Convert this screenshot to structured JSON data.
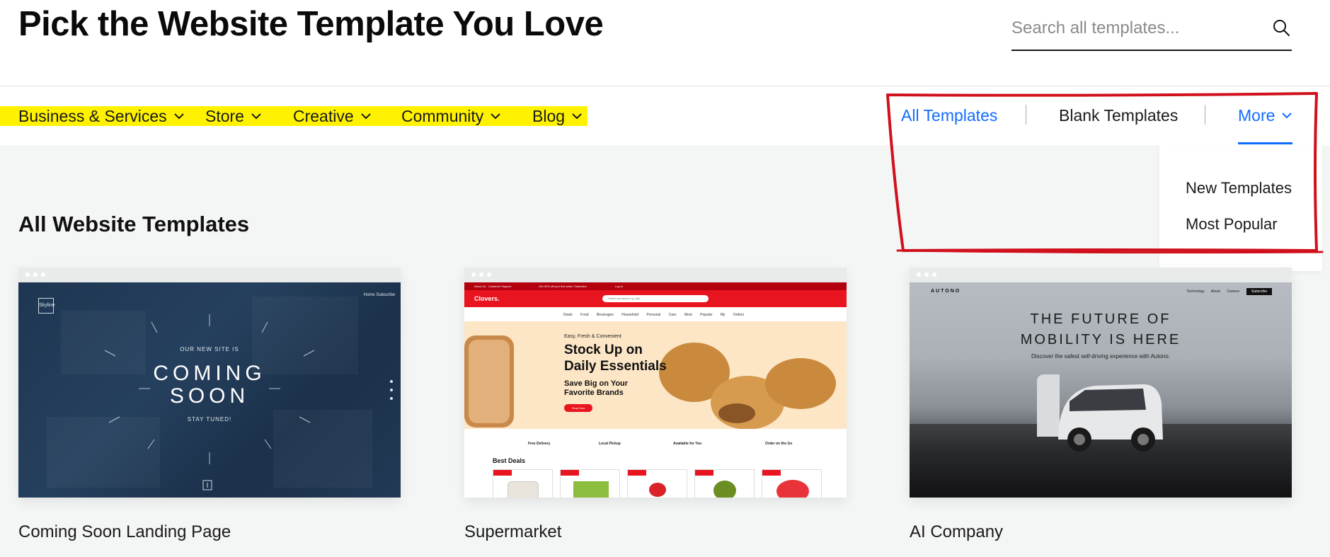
{
  "header": {
    "title": "Pick the Website Template You Love",
    "search_placeholder": "Search all templates..."
  },
  "nav": {
    "categories": [
      {
        "label": "Business & Services"
      },
      {
        "label": "Store"
      },
      {
        "label": "Creative"
      },
      {
        "label": "Community"
      },
      {
        "label": "Blog"
      }
    ],
    "highlight_color": "#fff200",
    "right": {
      "all": "All Templates",
      "blank": "Blank Templates",
      "more": "More"
    },
    "active_color": "#116dff"
  },
  "more_menu": {
    "items": [
      "New Templates",
      "Most Popular"
    ]
  },
  "annotation_color": "#d0101c",
  "section": {
    "title": "All Website Templates"
  },
  "templates": [
    {
      "name": "Coming Soon Landing Page",
      "thumb": {
        "logo": "Skyline",
        "nav": "Home   Subscribe",
        "kicker": "OUR NEW SITE IS",
        "headline_1": "COMING",
        "headline_2": "SOON",
        "footer": "STAY TUNED!"
      }
    },
    {
      "name": "Supermarket",
      "thumb": {
        "topbar": "About Us   Customer Support                                   Get 20% off your first order. Subscribe                                    Log In",
        "brand": "Clovers.",
        "search_placeholder": "Search products e.g. milk",
        "menu": "Deals Food Beverages Household Personal Care Most Popular My Orders",
        "hero_small": "Easy, Fresh & Convenient",
        "hero_big_1": "Stock Up on",
        "hero_big_2": "Daily Essentials",
        "hero_sub_1": "Save Big on Your",
        "hero_sub_2": "Favorite Brands",
        "hero_btn": "Shop Now",
        "features": [
          "Free Delivery",
          "Local Pickup",
          "Available for You",
          "Order on the Go"
        ],
        "best_deals": "Best Deals"
      }
    },
    {
      "name": "AI Company",
      "thumb": {
        "brand": "AUTONO",
        "nav": "Technology About Careers",
        "nav_button": "Subscribe",
        "headline_1": "THE FUTURE OF",
        "headline_2": "MOBILITY IS HERE",
        "tagline": "Discover the safest self-driving experience with Autono."
      }
    }
  ]
}
